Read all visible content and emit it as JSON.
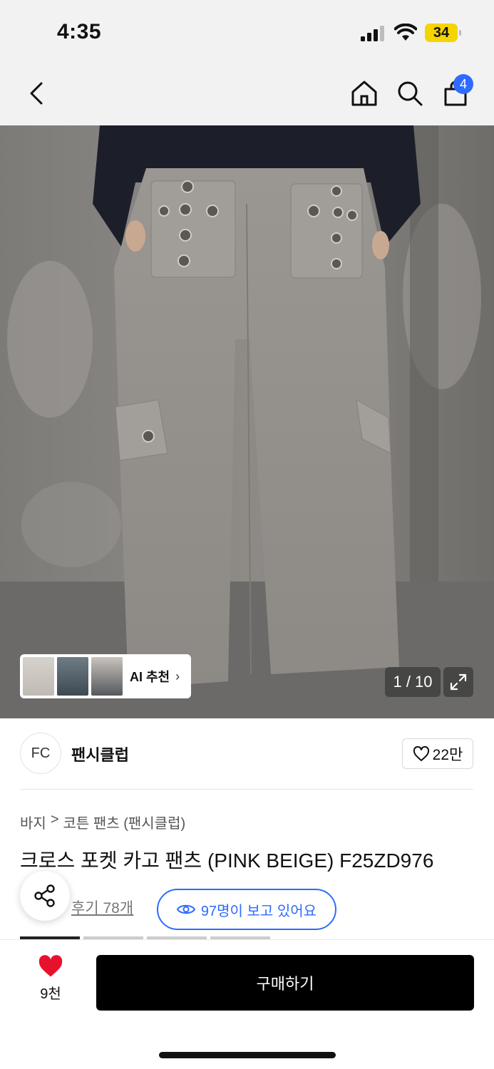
{
  "status_bar": {
    "time": "4:35",
    "battery": "34"
  },
  "nav": {
    "cart_count": "4",
    "icons": [
      "back-icon",
      "home-icon",
      "search-icon",
      "cart-icon"
    ]
  },
  "gallery": {
    "ai_label": "AI 추천",
    "counter": "1 / 10",
    "image_index": 1,
    "image_total": 10
  },
  "brand": {
    "logo_text": "FC",
    "name": "팬시클럽",
    "likes": "22만"
  },
  "product": {
    "breadcrumb": [
      "바지",
      "코튼 팬츠 (팬시클럽)"
    ],
    "breadcrumb_separator": ">",
    "title": "크로스 포켓 카고 팬츠 (PINK BEIGE) F25ZD976",
    "reviews": "후기 78개",
    "viewing": "97명이 보고 있어요"
  },
  "bottom": {
    "wish_count": "9천",
    "buy_label": "구매하기"
  },
  "colors": {
    "accent": "#2e6bff",
    "heart": "#e8112d",
    "battery": "#f5d400"
  }
}
